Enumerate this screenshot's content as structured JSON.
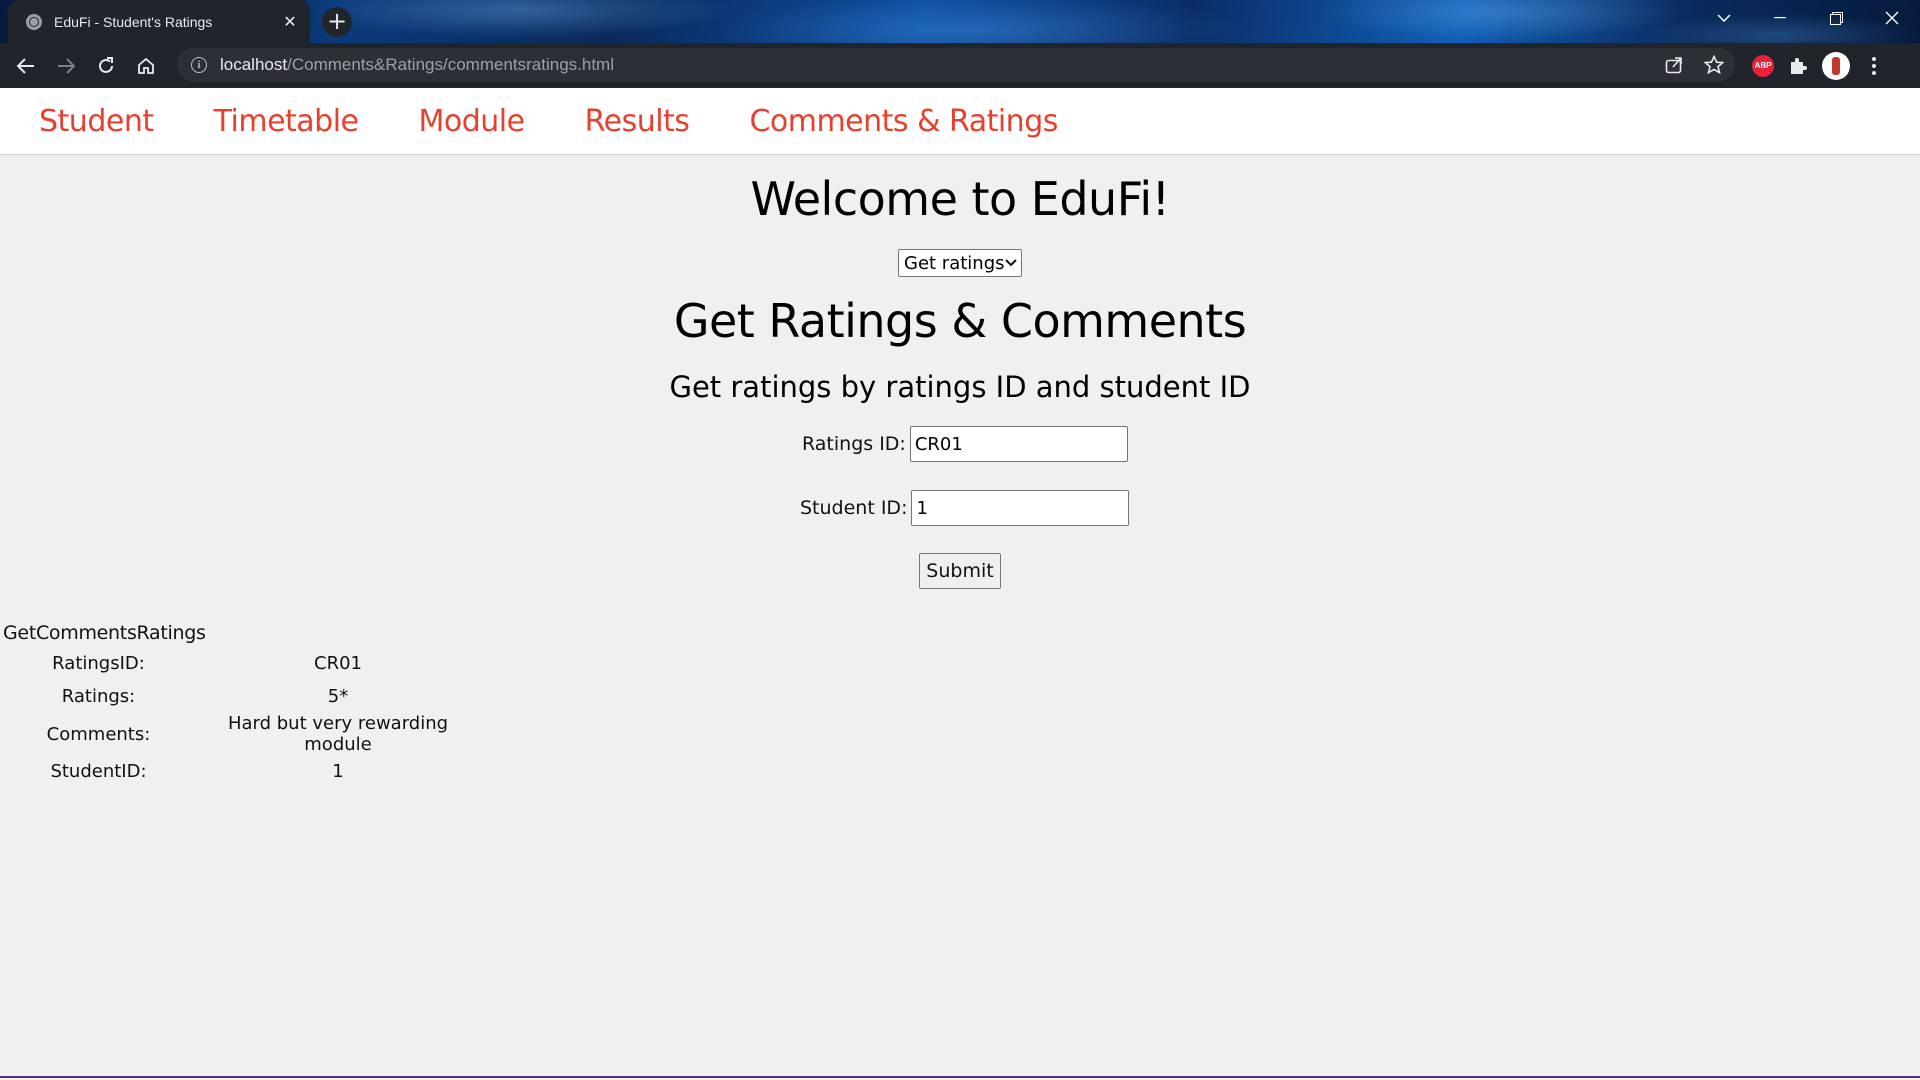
{
  "browser": {
    "tab_title": "EduFi - Student's Ratings",
    "url_host": "localhost",
    "url_path": "/Comments&Ratings/commentsratings.html",
    "extension_abp_label": "ABP"
  },
  "navbar": {
    "items": [
      {
        "label": "Student"
      },
      {
        "label": "Timetable"
      },
      {
        "label": "Module"
      },
      {
        "label": "Results"
      },
      {
        "label": "Comments & Ratings"
      }
    ],
    "color": "#e8402f"
  },
  "main": {
    "welcome": "Welcome to EduFi!",
    "mode_select_value": "Get ratings",
    "section_title": "Get Ratings & Comments",
    "sub_title": "Get ratings by ratings ID and student ID",
    "form": {
      "ratings_id_label": "Ratings ID:",
      "ratings_id_value": "CR01",
      "student_id_label": "Student ID:",
      "student_id_value": "1",
      "submit_label": "Submit"
    }
  },
  "result": {
    "title": "GetCommentsRatings",
    "rows": [
      {
        "key": "RatingsID:",
        "value": "CR01"
      },
      {
        "key": "Ratings:",
        "value": "5*"
      },
      {
        "key": "Comments:",
        "value": "Hard but very rewarding module"
      },
      {
        "key": "StudentID:",
        "value": "1"
      }
    ]
  }
}
